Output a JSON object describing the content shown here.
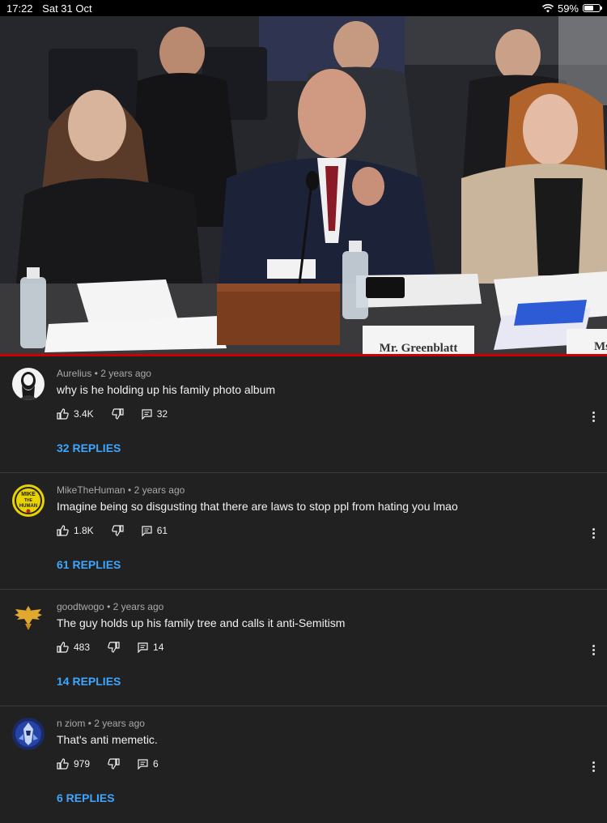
{
  "status_bar": {
    "time": "17:22",
    "date": "Sat 31 Oct",
    "battery": "59%",
    "battery_level": 0.59
  },
  "video": {
    "nameplate_main": "Mr. Greenblatt",
    "nameplate_partial": "Ms",
    "progress_color": "#cc0000"
  },
  "accent_color": "#3ea6ff",
  "comments": [
    {
      "author": "Aurelius",
      "sep": "•",
      "time": "2 years ago",
      "text": "why is he holding up his family photo album",
      "likes": "3.4K",
      "reply_count": "32",
      "replies_label": "32 REPLIES",
      "avatar_icon": "bearded-man-avatar-icon"
    },
    {
      "author": "MikeTheHuman",
      "sep": "•",
      "time": "2 years ago",
      "text": "Imagine being so disgusting that there are laws to stop ppl from hating you lmao",
      "likes": "1.8K",
      "reply_count": "61",
      "replies_label": "61 REPLIES",
      "avatar_icon": "mike-the-human-badge-icon",
      "avatar_text_top": "MIKE",
      "avatar_text_mid": "THE",
      "avatar_text_bot": "HUMAN"
    },
    {
      "author": "goodtwogo",
      "sep": "•",
      "time": "2 years ago",
      "text": "The guy holds up his family tree and calls it anti-Semitism",
      "likes": "483",
      "reply_count": "14",
      "replies_label": "14 REPLIES",
      "avatar_icon": "golden-eagle-avatar-icon"
    },
    {
      "author": "n ziom",
      "sep": "•",
      "time": "2 years ago",
      "text": "That's anti memetic.",
      "likes": "979",
      "reply_count": "6",
      "replies_label": "6 REPLIES",
      "avatar_icon": "blue-knight-avatar-icon"
    }
  ]
}
